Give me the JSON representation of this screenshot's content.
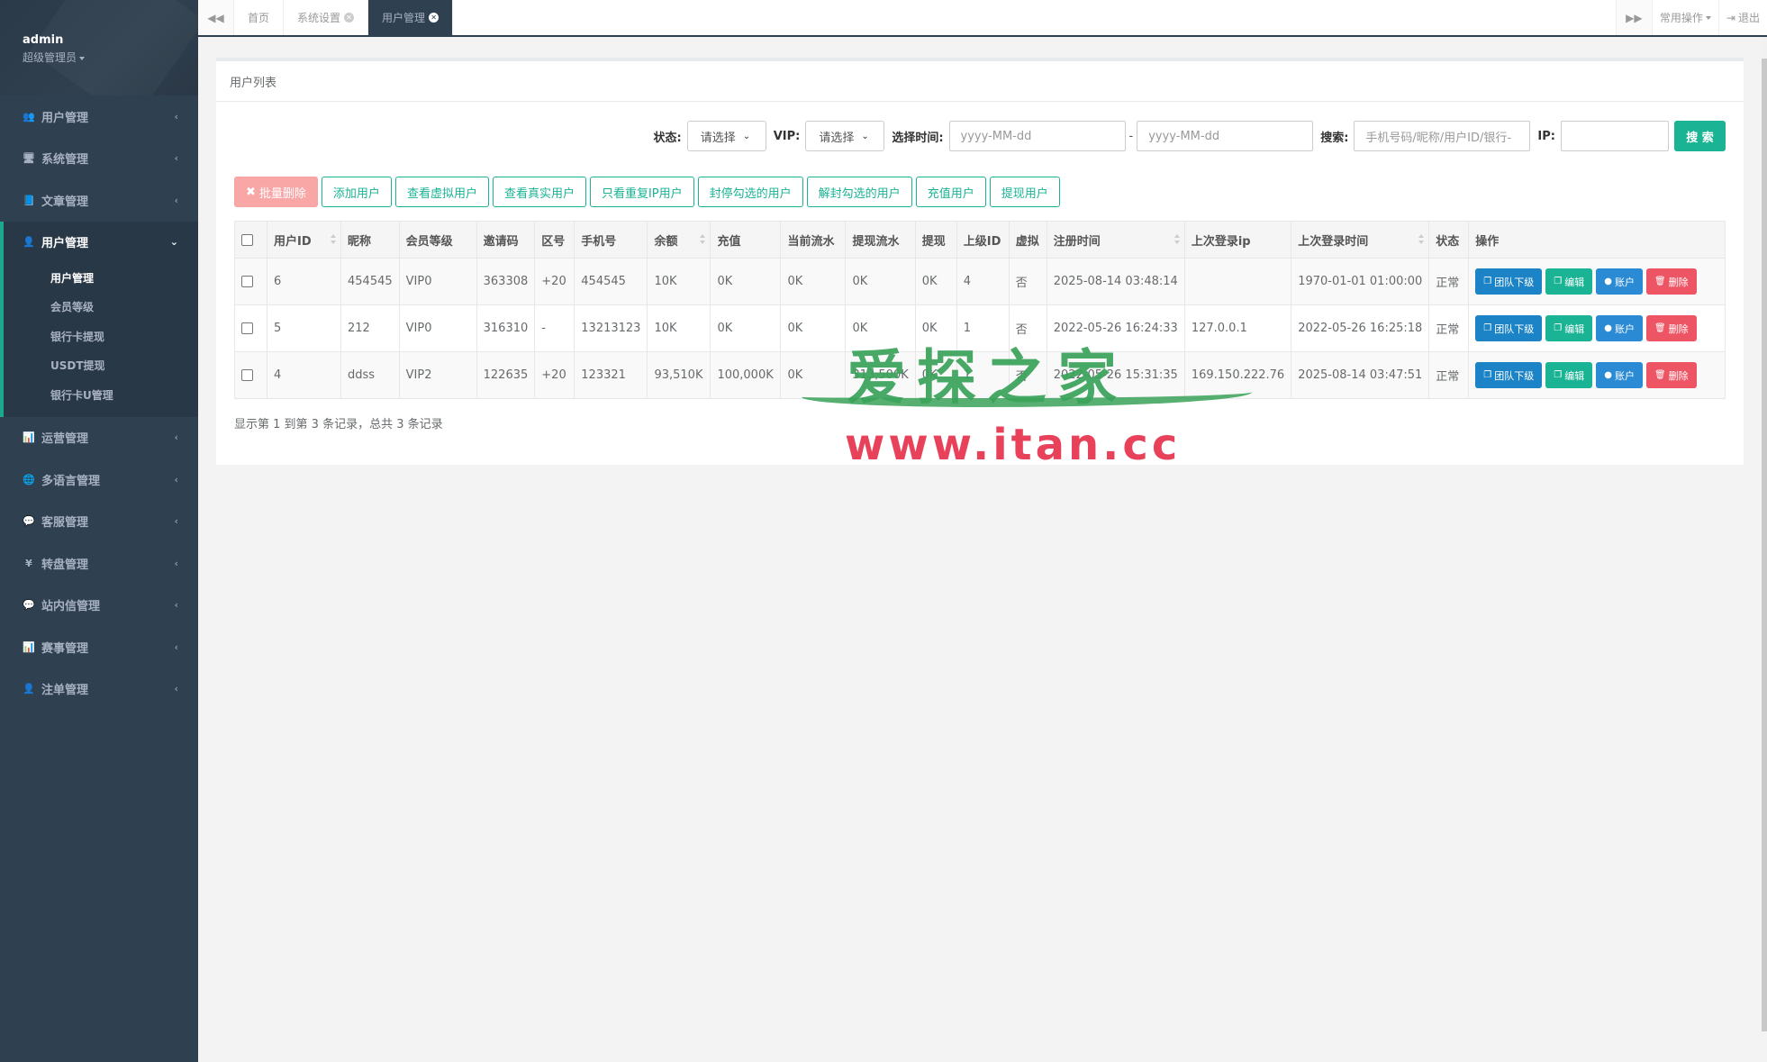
{
  "sidebar": {
    "user": {
      "name": "admin",
      "role": "超级管理员"
    },
    "menu": [
      {
        "icon": "users-icon",
        "glyph": "👥",
        "label": "用户管理"
      },
      {
        "icon": "desktop-icon",
        "glyph": "🖥",
        "label": "系统管理"
      },
      {
        "icon": "book-icon",
        "glyph": "📘",
        "label": "文章管理"
      },
      {
        "icon": "user-icon",
        "glyph": "👤",
        "label": "用户管理"
      },
      {
        "icon": "bar-chart-icon",
        "glyph": "📊",
        "label": "运营管理"
      },
      {
        "icon": "globe-icon",
        "glyph": "🌐",
        "label": "多语言管理"
      },
      {
        "icon": "comment-icon",
        "glyph": "💬",
        "label": "客服管理"
      },
      {
        "icon": "yen-icon",
        "glyph": "¥",
        "label": "转盘管理"
      },
      {
        "icon": "comment-icon",
        "glyph": "💬",
        "label": "站内信管理"
      },
      {
        "icon": "bar-chart-icon",
        "glyph": "📊",
        "label": "赛事管理"
      },
      {
        "icon": "user-icon",
        "glyph": "👤",
        "label": "注单管理"
      }
    ],
    "submenu": [
      "用户管理",
      "会员等级",
      "银行卡提现",
      "USDT提现",
      "银行卡U管理"
    ]
  },
  "topbar": {
    "tabs": [
      "首页",
      "系统设置",
      "用户管理"
    ],
    "common_ops": "常用操作",
    "logout": "退出"
  },
  "panel": {
    "title": "用户列表"
  },
  "filters": {
    "status_label": "状态:",
    "status_value": "请选择",
    "vip_label": "VIP:",
    "vip_value": "请选择",
    "time_label": "选择时间:",
    "date_from_placeholder": "yyyy-MM-dd",
    "date_sep": "-",
    "date_to_placeholder": "yyyy-MM-dd",
    "search_label": "搜索:",
    "search_placeholder": "手机号码/昵称/用户ID/银行-",
    "ip_label": "IP:",
    "ip_value": "",
    "search_button": "搜 索"
  },
  "toolbar": {
    "batch_delete": "批量删除",
    "add_user": "添加用户",
    "view_virtual": "查看虚拟用户",
    "view_real": "查看真实用户",
    "view_dup_ip": "只看重复IP用户",
    "ban_selected": "封停勾选的用户",
    "unban_selected": "解封勾选的用户",
    "recharge_user": "充值用户",
    "withdraw_user": "提现用户"
  },
  "table": {
    "headers": [
      "用户ID",
      "昵称",
      "会员等级",
      "邀请码",
      "区号",
      "手机号",
      "余额",
      "充值",
      "当前流水",
      "提现流水",
      "提现",
      "上级ID",
      "虚拟",
      "注册时间",
      "上次登录ip",
      "上次登录时间",
      "状态",
      "操作"
    ],
    "rows": [
      [
        "6",
        "454545",
        "VIP0",
        "363308",
        "+20",
        "454545",
        "10K",
        "0K",
        "0K",
        "0K",
        "0K",
        "4",
        "否",
        "2025-08-14 03:48:14",
        "",
        "1970-01-01 01:00:00",
        "正常"
      ],
      [
        "5",
        "212",
        "VIP0",
        "316310",
        "-",
        "13213123",
        "10K",
        "0K",
        "0K",
        "0K",
        "0K",
        "1",
        "否",
        "2022-05-26 16:24:33",
        "127.0.0.1",
        "2022-05-26 16:25:18",
        "正常"
      ],
      [
        "4",
        "ddss",
        "VIP2",
        "122635",
        "+20",
        "123321",
        "93,510K",
        "100,000K",
        "0K",
        "313,500K",
        "0K",
        "1",
        "否",
        "2022-05-26 15:31:35",
        "169.150.222.76",
        "2025-08-14 03:47:51",
        "正常"
      ]
    ],
    "row_actions": [
      "团队下级",
      "编辑",
      "账户",
      "删除"
    ]
  },
  "pager": {
    "summary": "显示第 1 到第 3 条记录，总共 3 条记录"
  },
  "watermark": {
    "cn": "爱探之家",
    "url": "www.itan.cc"
  },
  "colors": {
    "sidebar": "#2f4050",
    "accent": "#1ab394",
    "primary": "#1c84c6",
    "danger": "#ed5565"
  }
}
